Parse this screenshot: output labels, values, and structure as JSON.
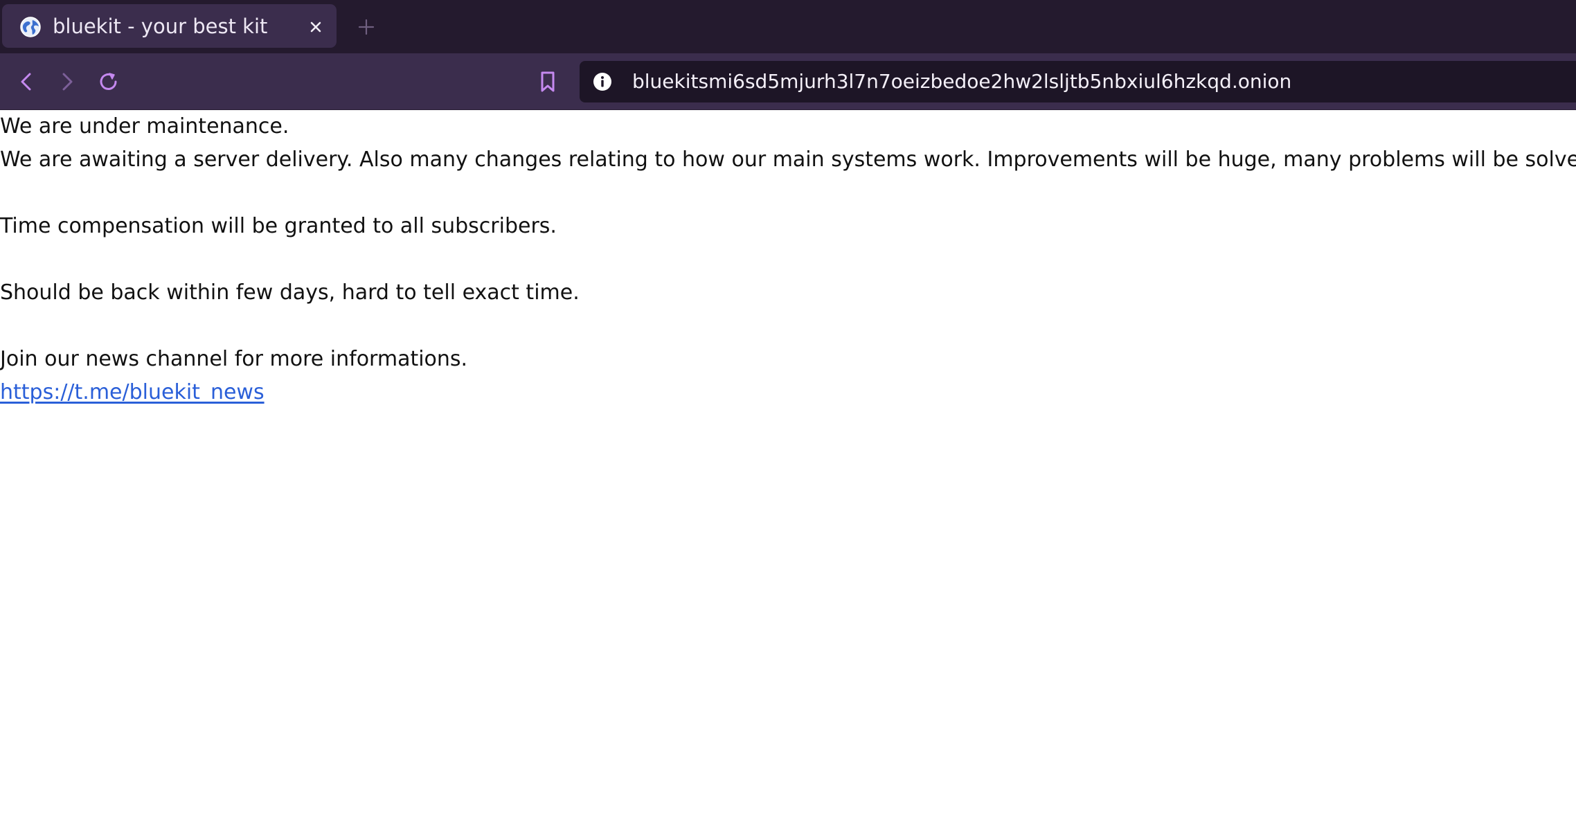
{
  "browser": {
    "tab": {
      "title": "bluekit - your best kit",
      "favicon": "globe-icon",
      "close": "close-icon"
    },
    "new_tab": "plus-icon",
    "nav": {
      "back": "chevron-left-icon",
      "forward": "chevron-right-icon",
      "reload": "reload-icon",
      "bookmark": "bookmark-icon"
    },
    "url": {
      "info_icon": "info-icon",
      "text": "bluekitsmi6sd5mjurh3l7n7oeizbedoe2hw2lsljtb5nbxiul6hzkqd.onion"
    },
    "colors": {
      "tabstrip_bg": "#241a2e",
      "toolbar_bg": "#3b2d4d",
      "urlbar_bg": "#1d1526",
      "accent": "#c589f0",
      "link": "#2a5fd8"
    }
  },
  "page": {
    "lines": [
      "We are under maintenance.",
      "We are awaiting a server delivery. Also many changes relating to how our main systems work. Improvements will be huge, many problems will be solved.",
      "Time compensation will be granted to all subscribers.",
      "Should be back within few days, hard to tell exact time.",
      "Join our news channel for more informations."
    ],
    "link": "https://t.me/bluekit_news"
  }
}
